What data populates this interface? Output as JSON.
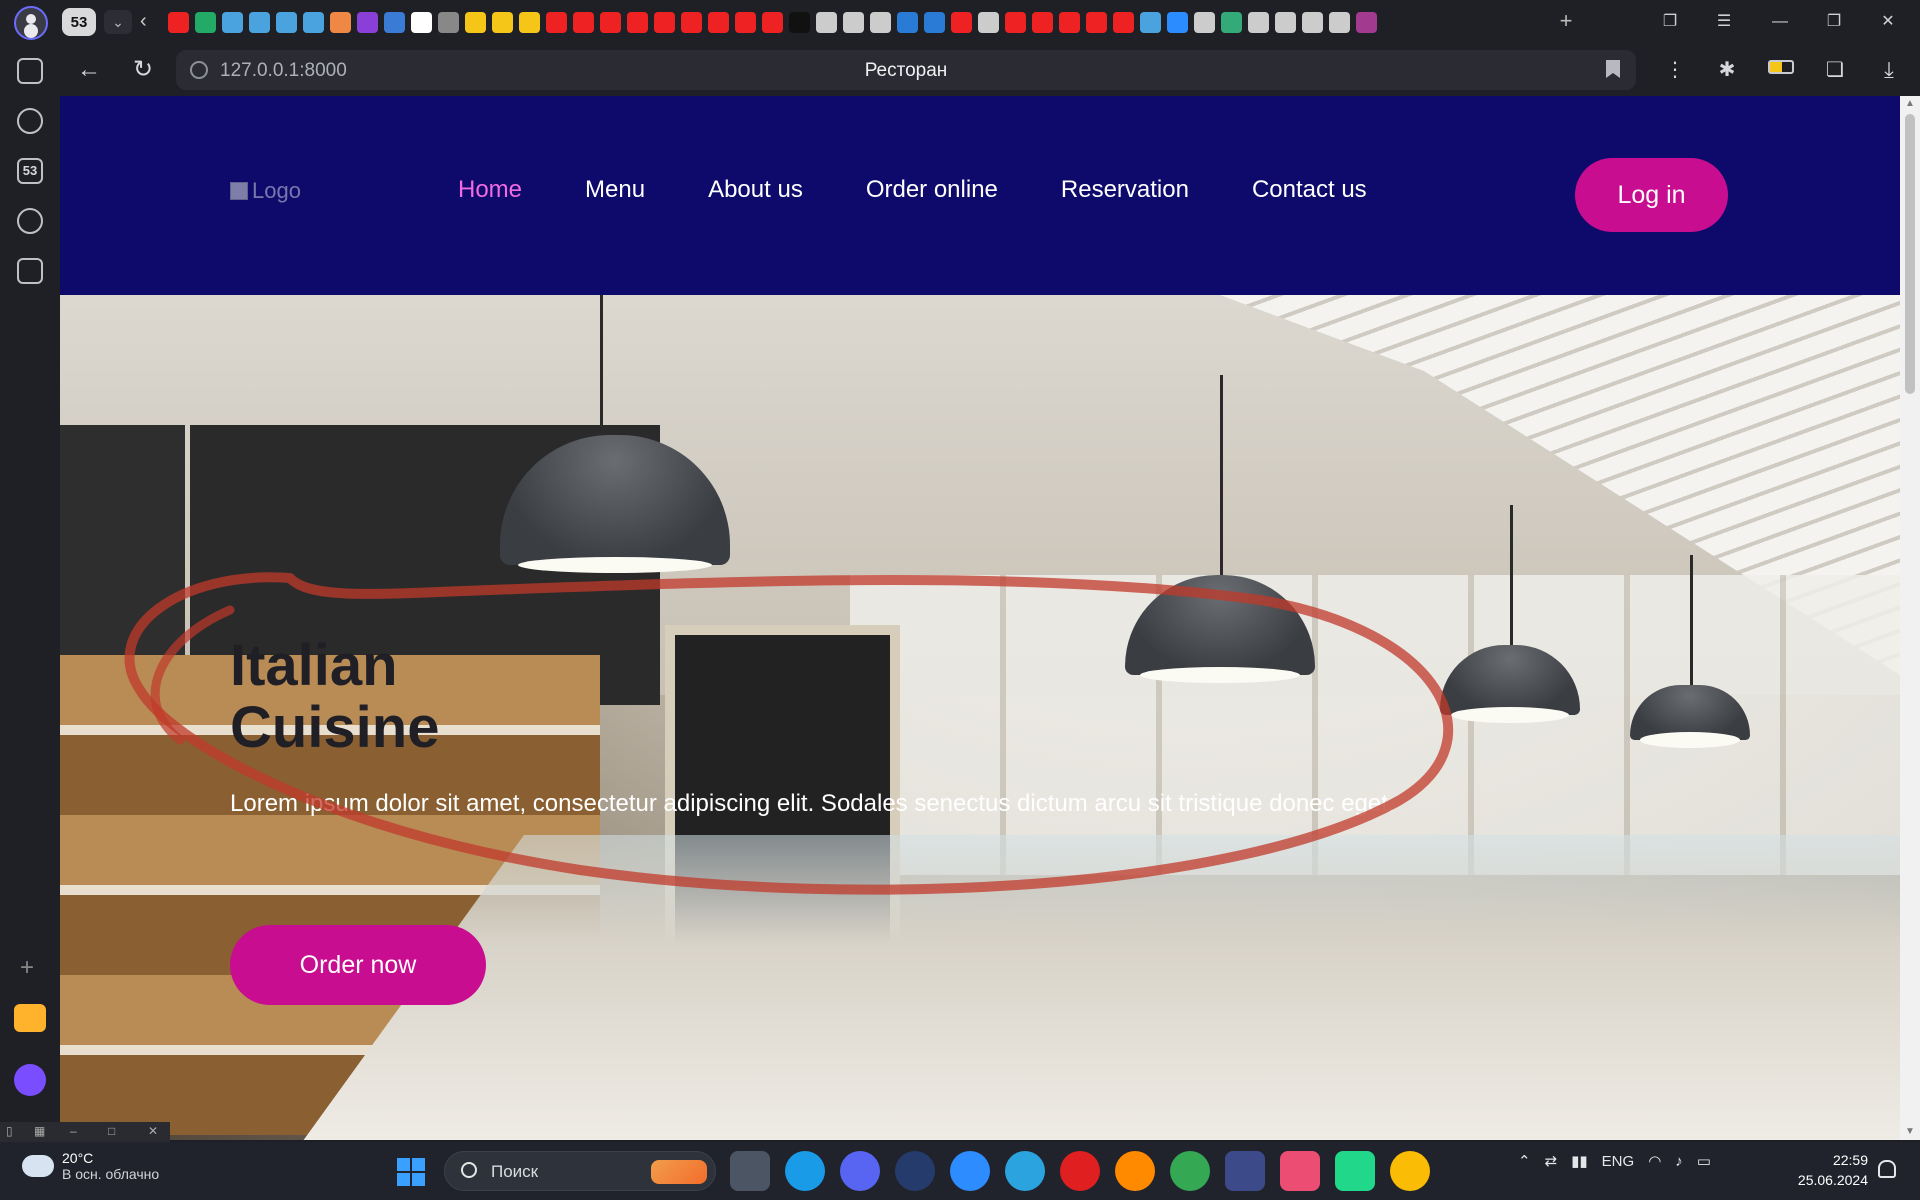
{
  "browser": {
    "tab_count": "53",
    "url": "127.0.0.1:8000",
    "page_title": "Ресторан",
    "sidebar_tab_count": "53"
  },
  "site": {
    "logo_alt": "Logo",
    "nav": [
      {
        "label": "Home",
        "active": true
      },
      {
        "label": "Menu",
        "active": false
      },
      {
        "label": "About us",
        "active": false
      },
      {
        "label": "Order online",
        "active": false
      },
      {
        "label": "Reservation",
        "active": false
      },
      {
        "label": "Contact us",
        "active": false
      }
    ],
    "login_label": "Log in",
    "hero": {
      "title_line1": "Italian",
      "title_line2": "Cuisine",
      "text": "Lorem ipsum dolor sit amet, consectetur adipiscing elit. Sodales senectus dictum arcu sit tristique donec eget.",
      "cta_label": "Order now"
    },
    "colors": {
      "header_bg": "#0d0a6b",
      "accent": "#c80d90",
      "nav_active": "#f06ae0",
      "annotation": "#c0392b"
    }
  },
  "taskbar": {
    "weather_temp": "20°C",
    "weather_desc": "В осн. облачно",
    "search_label": "Поиск",
    "lang": "ENG",
    "time": "22:59",
    "date": "25.06.2024"
  }
}
